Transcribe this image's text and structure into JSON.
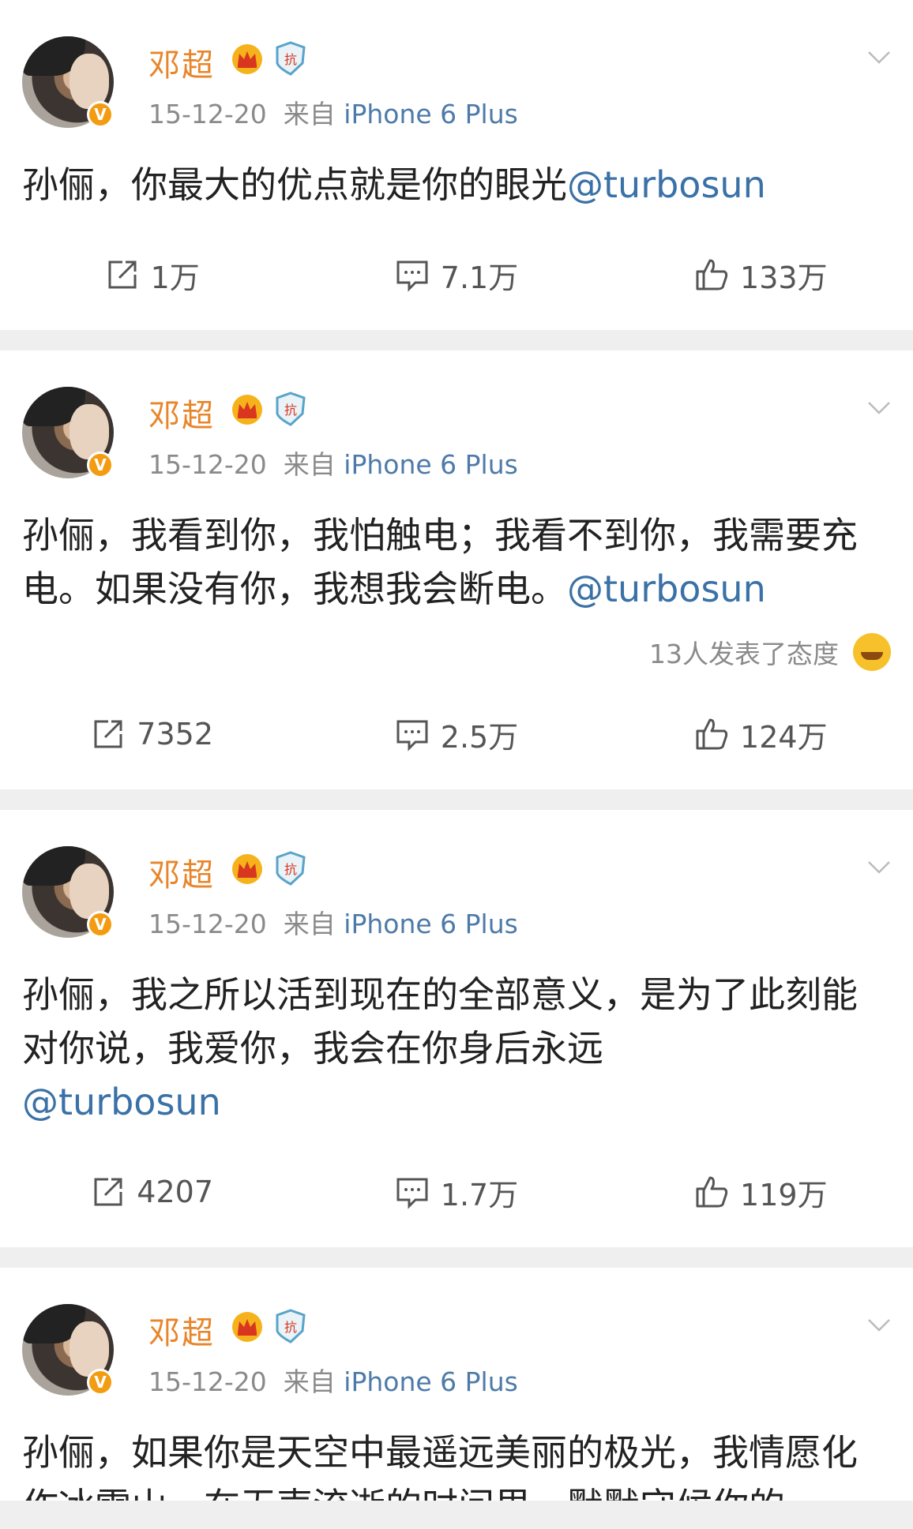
{
  "posts": [
    {
      "user": "邓超",
      "time": "15-12-20",
      "source_prefix": "来自",
      "source": "iPhone 6 Plus",
      "text": "孙俪，你最大的优点就是你的眼光",
      "mention": "@turbosun",
      "reactions": "",
      "repost": "1万",
      "comment": "7.1万",
      "like": "133万"
    },
    {
      "user": "邓超",
      "time": "15-12-20",
      "source_prefix": "来自",
      "source": "iPhone 6 Plus",
      "text": "孙俪，我看到你，我怕触电；我看不到你，我需要充电。如果没有你，我想我会断电。",
      "mention": "@turbosun",
      "reactions": "13人发表了态度",
      "repost": "7352",
      "comment": "2.5万",
      "like": "124万"
    },
    {
      "user": "邓超",
      "time": "15-12-20",
      "source_prefix": "来自",
      "source": "iPhone 6 Plus",
      "text": "孙俪，我之所以活到现在的全部意义，是为了此刻能对你说，我爱你，我会在你身后永远",
      "mention": "@turbosun",
      "reactions": "",
      "repost": "4207",
      "comment": "1.7万",
      "like": "119万"
    },
    {
      "user": "邓超",
      "time": "15-12-20",
      "source_prefix": "来自",
      "source": "iPhone 6 Plus",
      "text": "孙俪，如果你是天空中最遥远美丽的极光，我情愿化作冰雪山，在无声流逝的时间里，默默守候你的",
      "mention": "",
      "reactions": "",
      "repost": "",
      "comment": "",
      "like": ""
    }
  ],
  "colors": {
    "name": "#e8852a",
    "link": "#3a71a6",
    "meta": "#8a8a8a"
  }
}
